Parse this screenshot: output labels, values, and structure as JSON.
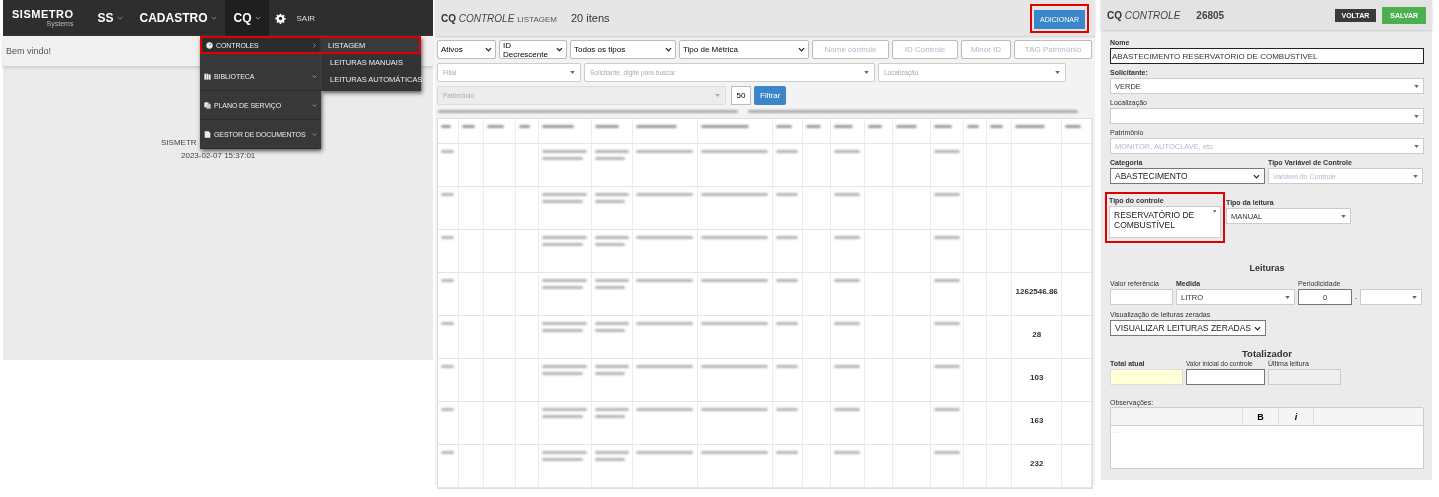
{
  "home": {
    "navbar": {
      "logo": "SISMETRO",
      "logo_sub": "Systems",
      "menus": [
        {
          "label": "SS",
          "open": false
        },
        {
          "label": "CADASTRO",
          "open": false
        },
        {
          "label": "CQ",
          "open": true
        }
      ],
      "exit": "SAIR"
    },
    "welcome": "Bem vindo!",
    "version": "SISMETR",
    "timestamp": "2023-02-07 15:37:01",
    "dropdown": [
      {
        "label": "CONTROLES",
        "submenu": true,
        "highlighted": true
      },
      {
        "label": "BIBLIOTECA",
        "submenu": false,
        "highlighted": false
      },
      {
        "label": "PLANO DE SERVIÇO",
        "submenu": false,
        "highlighted": false
      },
      {
        "label": "GESTOR DE DOCUMENTOS",
        "submenu": false,
        "highlighted": false
      }
    ],
    "submenu": [
      {
        "label": "LISTAGEM",
        "highlighted": true
      },
      {
        "label": "LEITURAS MANUAIS",
        "highlighted": false
      },
      {
        "label": "LEITURAS AUTOMÁTICAS",
        "highlighted": false
      }
    ]
  },
  "list": {
    "title_module": "CQ",
    "title_entity": "CONTROLE",
    "title_view": "LISTAGEM",
    "count": "20 itens",
    "add_button": {
      "label": "ADICIONAR",
      "highlighted": true
    },
    "filters": [
      {
        "kind": "select",
        "value": "Ativos"
      },
      {
        "kind": "select",
        "value": "ID Decrescente"
      },
      {
        "kind": "select",
        "value": "Todos os tipos"
      },
      {
        "kind": "select",
        "value": "Tipo de Métrica"
      },
      {
        "kind": "input",
        "placeholder": "Nome controle"
      },
      {
        "kind": "input",
        "placeholder": "ID Controle"
      },
      {
        "kind": "input",
        "placeholder": "Minor ID"
      },
      {
        "kind": "input",
        "placeholder": "TAG Patrimônio"
      }
    ],
    "search_filters": [
      {
        "placeholder": "Filial"
      },
      {
        "placeholder": "Solicitante, digite para buscar"
      },
      {
        "placeholder": "Localização"
      }
    ],
    "asset_filter": {
      "placeholder": "Patrimônio",
      "disabled": true
    },
    "page_size": "50",
    "filter_button": "Filtrar",
    "rows": [
      {
        "blurred": true
      },
      {
        "blurred": true
      },
      {
        "blurred": true
      },
      {
        "blurred": true,
        "last_reading": "1262546.86"
      },
      {
        "blurred": true,
        "last_reading": "28"
      },
      {
        "blurred": true,
        "last_reading": "103"
      },
      {
        "blurred": true,
        "last_reading": "163"
      },
      {
        "blurred": true,
        "last_reading": "232"
      }
    ]
  },
  "form": {
    "title_module": "CQ",
    "title_entity": "CONTROLE",
    "id": "26805",
    "back_button": "VOLTAR",
    "save_button": "SALVAR",
    "nome": {
      "label": "Nome",
      "value": "ABASTECIMENTO RESERVATORIO DE COMBUSTIVEL"
    },
    "solicitante": {
      "label": "Solicitante:",
      "value": "VERDE"
    },
    "localizacao": {
      "label": "Localização"
    },
    "patrimonio": {
      "label": "Patrimônio",
      "placeholder": "MONITOR, AUTOCLAVE, etc"
    },
    "categoria": {
      "label": "Categoria",
      "value": "ABASTECIMENTO"
    },
    "tipo_variavel": {
      "label": "Tipo Variável de Controle",
      "placeholder": "Variável do Controle"
    },
    "tipo_controle": {
      "label": "Tipo do controle",
      "value": "RESERVATÓRIO DE COMBUSTÍVEL",
      "highlighted": true
    },
    "tipo_leitura": {
      "label": "Tipo da leitura",
      "value": "MANUAL"
    },
    "leituras_heading": "Leituras",
    "valor_referencia": {
      "label": "Valor referência"
    },
    "medida": {
      "label": "Medida",
      "value": "LITRO"
    },
    "periodicidade": {
      "label": "Periodicidade",
      "value": "0",
      "separator": "-"
    },
    "visualizacao": {
      "label": "Visualização de leituras zeradas",
      "value": "VISUALIZAR LEITURAS ZERADAS"
    },
    "totalizador_heading": "Totalizador",
    "total_atual": {
      "label": "Total atual"
    },
    "valor_inicial": {
      "label": "Valor inicial do controle"
    },
    "ultima_leitura": {
      "label": "Última leitura",
      "disabled": true
    },
    "observacoes": {
      "label": "Observações:",
      "bold": "B",
      "italic": "i",
      "placeholder": "...."
    }
  }
}
